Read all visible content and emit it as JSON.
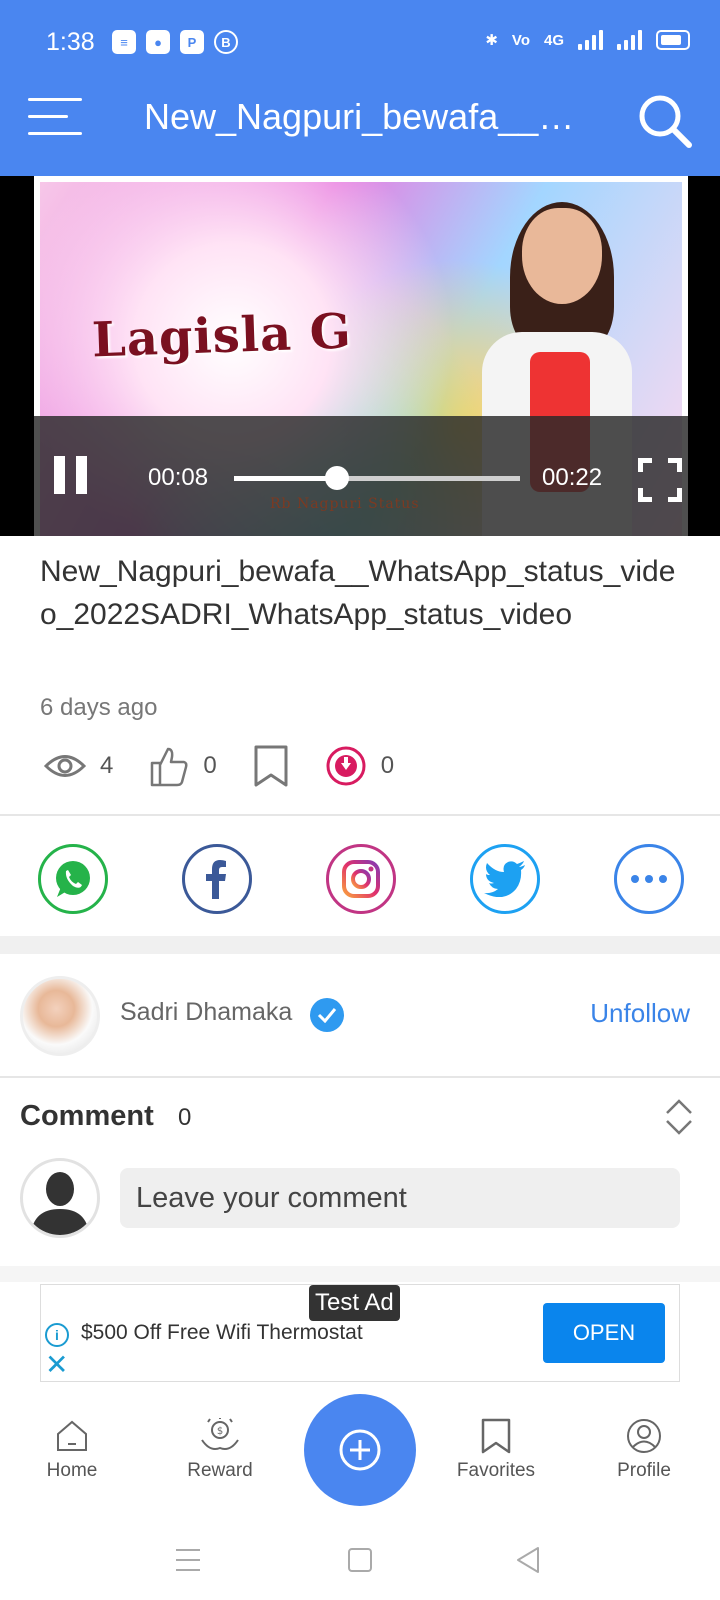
{
  "status_bar": {
    "time": "1:38",
    "network": "4G"
  },
  "app_bar": {
    "title": "New_Nagpuri_bewafa__WhatsApp_status_video_2022SADRI_WhatsApp_status_video"
  },
  "player": {
    "overlay_text": "Lagisla G",
    "watermark": "Rb Nagpuri Status",
    "current_time": "00:08",
    "duration": "00:22",
    "progress": 0.36
  },
  "video": {
    "title": "New_Nagpuri_bewafa__WhatsApp_status_video_2022SADRI_WhatsApp_status_video",
    "posted": "6 days ago",
    "views": "4",
    "likes": "0",
    "downloads": "0"
  },
  "share": {
    "items": [
      "whatsapp",
      "facebook",
      "instagram",
      "twitter",
      "more"
    ]
  },
  "author": {
    "name": "Sadri Dhamaka",
    "follow_label": "Unfollow"
  },
  "comments": {
    "label": "Comment",
    "count": "0",
    "placeholder": "Leave your comment"
  },
  "ad": {
    "badge": "Test Ad",
    "text": "$500 Off Free Wifi Thermostat",
    "cta": "OPEN"
  },
  "bottom_nav": {
    "items": [
      {
        "label": "Home"
      },
      {
        "label": "Reward"
      },
      {
        "label": "Favorites"
      },
      {
        "label": "Profile"
      }
    ]
  },
  "colors": {
    "primary": "#4a86f0",
    "download": "#d81b60",
    "whatsapp": "#25b34a",
    "facebook": "#3b5998",
    "instagram": "#c13584",
    "twitter": "#1da1f2",
    "link": "#3a84e8",
    "ad_button": "#0a85ed"
  }
}
